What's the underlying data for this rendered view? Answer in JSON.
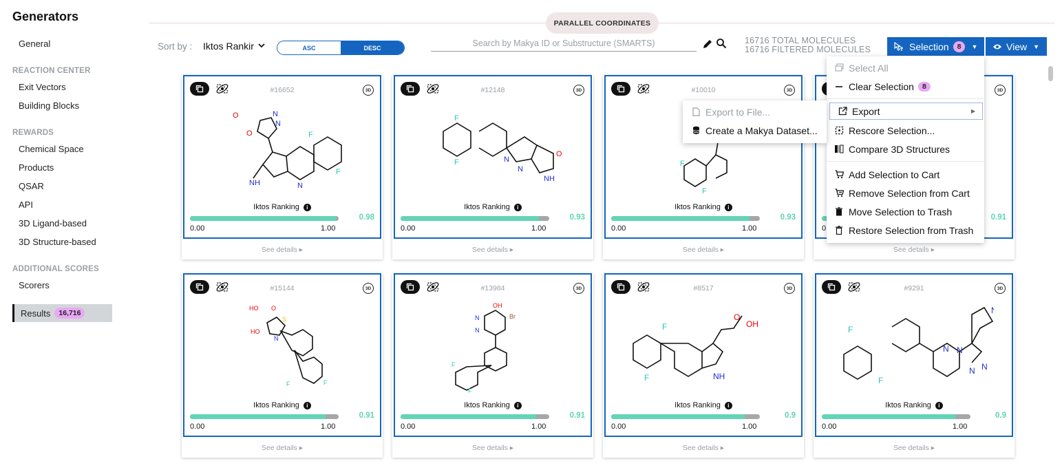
{
  "sidebar": {
    "title": "Generators",
    "general": "General",
    "sections": [
      {
        "title": "REACTION CENTER",
        "items": [
          "Exit Vectors",
          "Building Blocks"
        ]
      },
      {
        "title": "REWARDS",
        "items": [
          "Chemical Space",
          "Products",
          "QSAR",
          "API",
          "3D Ligand-based",
          "3D Structure-based"
        ]
      },
      {
        "title": "ADDITIONAL SCORES",
        "items": [
          "Scorers"
        ]
      }
    ],
    "results_label": "Results",
    "results_count": "16,716"
  },
  "topbar": {
    "parallel_coords": "PARALLEL COORDINATES",
    "sort_label": "Sort by :",
    "sort_value": "Iktos Rankir",
    "asc": "ASC",
    "desc": "DESC",
    "search_placeholder": "Search by Makya ID or Substructure (SMARTS)",
    "total": "16716 TOTAL MOLECULES",
    "filtered": "16716 FILTERED MOLECULES",
    "selection_label": "Selection",
    "selection_count": "8",
    "view_label": "View"
  },
  "card_common": {
    "rank_label": "Iktos Ranking",
    "min": "0.00",
    "max": "1.00",
    "details": "See details ▸",
    "d3": "3D",
    "info": "i"
  },
  "cards": [
    {
      "id": "#16652",
      "score": "0.98",
      "fraction": 0.98
    },
    {
      "id": "#12148",
      "score": "0.93",
      "fraction": 0.93
    },
    {
      "id": "#10010",
      "score": "0.93",
      "fraction": 0.93
    },
    {
      "id": "",
      "score": "0.91",
      "fraction": 0.91
    },
    {
      "id": "#15144",
      "score": "0.91",
      "fraction": 0.91
    },
    {
      "id": "#13984",
      "score": "0.91",
      "fraction": 0.91
    },
    {
      "id": "#8517",
      "score": "0.9",
      "fraction": 0.9
    },
    {
      "id": "#9291",
      "score": "0.9",
      "fraction": 0.9
    }
  ],
  "selection_menu": {
    "select_all": "Select All",
    "clear_selection": "Clear Selection",
    "clear_count": "8",
    "export": "Export",
    "rescore": "Rescore Selection...",
    "compare": "Compare 3D Structures",
    "add_cart": "Add Selection to Cart",
    "remove_cart": "Remove Selection from Cart",
    "move_trash": "Move Selection to Trash",
    "restore_trash": "Restore Selection from Trash"
  },
  "export_menu": {
    "export_file": "Export to File...",
    "create_dataset": "Create a Makya Dataset..."
  },
  "colors": {
    "primary": "#1565c0",
    "score_green": "#63d4b5",
    "badge_pink": "#e9a8f4"
  }
}
